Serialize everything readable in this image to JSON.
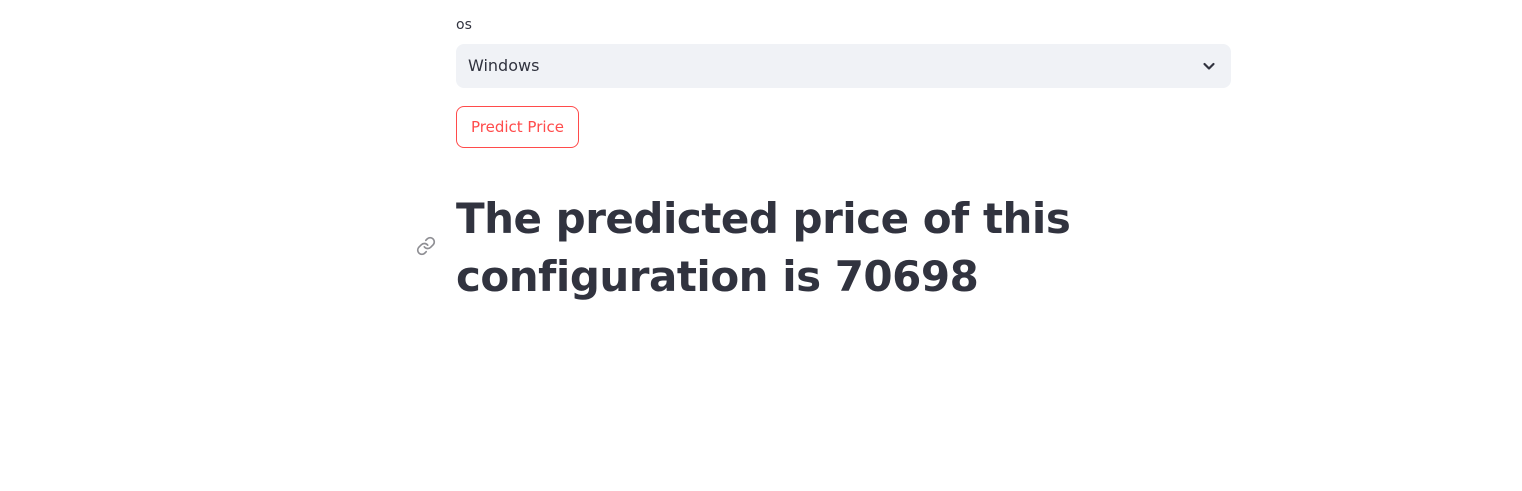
{
  "os_field": {
    "label": "os",
    "selected_value": "Windows",
    "icon": "chevron-down-icon"
  },
  "predict_button": {
    "label": "Predict Price",
    "color": "#ff4b4b"
  },
  "result": {
    "heading": "The predicted price of this configuration is 70698",
    "anchor_icon": "link-icon"
  },
  "colors": {
    "text": "#31333f",
    "select_background": "#f0f2f6",
    "accent": "#ff4b4b"
  }
}
